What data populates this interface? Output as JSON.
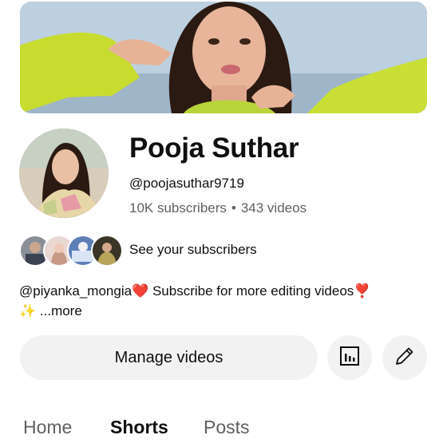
{
  "channel": {
    "name": "Pooja Suthar",
    "handle": "@poojasuthar9719",
    "subscribers": "10K subscribers",
    "separator": "•",
    "videos": "343 videos"
  },
  "subscribers_row": {
    "label": "See your subscribers"
  },
  "description": {
    "mention": "@piyanka_mongia",
    "heart_emoji": "❤️",
    "text": " Subscribe for more editing videos",
    "exclaim_emoji": "❣️",
    "sparkle_emoji": "✨",
    "more": " ...more"
  },
  "actions": {
    "manage_label": "Manage videos",
    "analytics_icon": "analytics-icon",
    "edit_icon": "pencil-icon"
  },
  "tabs": [
    {
      "label": "Home",
      "active": false
    },
    {
      "label": "Shorts",
      "active": true
    },
    {
      "label": "Posts",
      "active": false
    }
  ],
  "colors": {
    "text": "#0f0f0f",
    "secondary_text": "#606060",
    "button_bg": "#f2f2f2",
    "heart": "#e62117"
  }
}
